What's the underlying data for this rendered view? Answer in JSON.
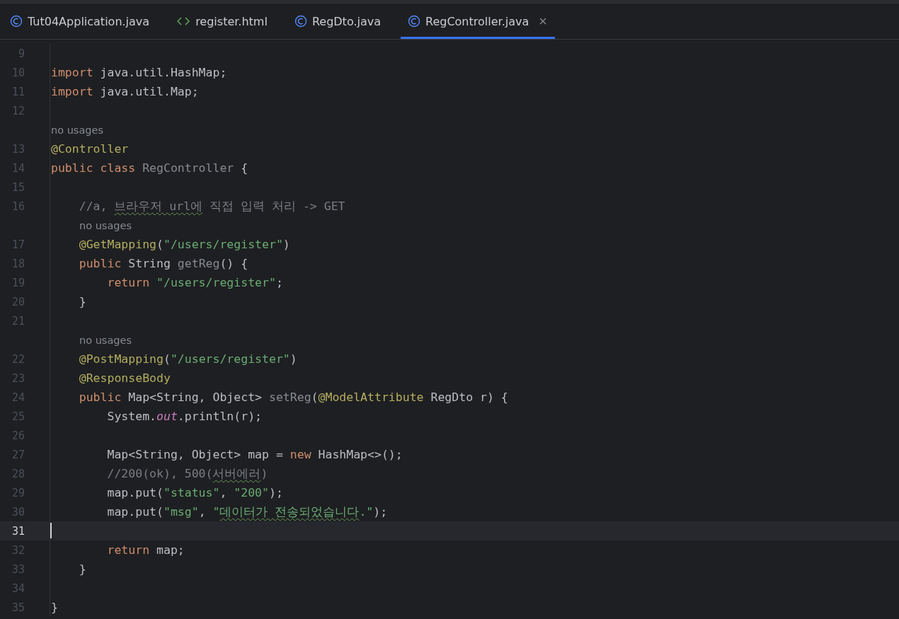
{
  "tabs": [
    {
      "label": "Tut04Application.java",
      "kind": "class",
      "selected": false,
      "closable": false
    },
    {
      "label": "register.html",
      "kind": "html",
      "selected": false,
      "closable": false
    },
    {
      "label": "RegDto.java",
      "kind": "class",
      "selected": false,
      "closable": false
    },
    {
      "label": "RegController.java",
      "kind": "class",
      "selected": true,
      "closable": true
    }
  ],
  "lines": [
    {
      "kind": "code",
      "number": "9",
      "current": false
    },
    {
      "kind": "code",
      "number": "10",
      "current": false,
      "tokens": [
        {
          "text": "import ",
          "kind": "keyword"
        },
        {
          "text": "java.util.HashMap;",
          "kind": "plain"
        }
      ]
    },
    {
      "kind": "code",
      "number": "11",
      "current": false,
      "tokens": [
        {
          "text": "import ",
          "kind": "keyword"
        },
        {
          "text": "java.util.Map;",
          "kind": "plain"
        }
      ]
    },
    {
      "kind": "code",
      "number": "12",
      "current": false
    },
    {
      "kind": "hint",
      "text": "no usages"
    },
    {
      "kind": "code",
      "number": "13",
      "current": false,
      "tokens": [
        {
          "text": "@Controller",
          "kind": "annotation"
        }
      ]
    },
    {
      "kind": "code",
      "number": "14",
      "current": false,
      "tokens": [
        {
          "text": "public class ",
          "kind": "keyword"
        },
        {
          "text": "RegController",
          "kind": "unused"
        },
        {
          "text": " {",
          "kind": "plain"
        }
      ]
    },
    {
      "kind": "code",
      "number": "15",
      "current": false
    },
    {
      "kind": "code",
      "number": "16",
      "current": false,
      "tokens": [
        {
          "text": "    //a, ",
          "kind": "comment"
        },
        {
          "text": "브라우저 url에",
          "kind": "comment-typo"
        },
        {
          "text": " 직접 입력 처리 -> GET",
          "kind": "comment"
        }
      ]
    },
    {
      "kind": "hint",
      "text": "no usages"
    },
    {
      "kind": "code",
      "number": "17",
      "current": false,
      "tokens": [
        {
          "text": "    @GetMapping",
          "kind": "annotation"
        },
        {
          "text": "(",
          "kind": "plain"
        },
        {
          "text": "\"/users/register\"",
          "kind": "string"
        },
        {
          "text": ")",
          "kind": "plain"
        }
      ]
    },
    {
      "kind": "code",
      "number": "18",
      "current": false,
      "tokens": [
        {
          "text": "    public ",
          "kind": "keyword"
        },
        {
          "text": "String ",
          "kind": "plain"
        },
        {
          "text": "getReg",
          "kind": "unused"
        },
        {
          "text": "() {",
          "kind": "plain"
        }
      ]
    },
    {
      "kind": "code",
      "number": "19",
      "current": false,
      "tokens": [
        {
          "text": "        return ",
          "kind": "keyword"
        },
        {
          "text": "\"/users/register\"",
          "kind": "string"
        },
        {
          "text": ";",
          "kind": "plain"
        }
      ]
    },
    {
      "kind": "code",
      "number": "20",
      "current": false,
      "tokens": [
        {
          "text": "    }",
          "kind": "plain"
        }
      ]
    },
    {
      "kind": "code",
      "number": "21",
      "current": false
    },
    {
      "kind": "hint",
      "text": "no usages"
    },
    {
      "kind": "code",
      "number": "22",
      "current": false,
      "tokens": [
        {
          "text": "    @PostMapping",
          "kind": "annotation"
        },
        {
          "text": "(",
          "kind": "plain"
        },
        {
          "text": "\"/users/register\"",
          "kind": "string"
        },
        {
          "text": ")",
          "kind": "plain"
        }
      ]
    },
    {
      "kind": "code",
      "number": "23",
      "current": false,
      "tokens": [
        {
          "text": "    @ResponseBody",
          "kind": "annotation"
        }
      ]
    },
    {
      "kind": "code",
      "number": "24",
      "current": false,
      "tokens": [
        {
          "text": "    public ",
          "kind": "keyword"
        },
        {
          "text": "Map<String, Object> ",
          "kind": "plain"
        },
        {
          "text": "setReg",
          "kind": "unused"
        },
        {
          "text": "(",
          "kind": "plain"
        },
        {
          "text": "@ModelAttribute",
          "kind": "annotation"
        },
        {
          "text": " RegDto r) {",
          "kind": "plain"
        }
      ]
    },
    {
      "kind": "code",
      "number": "25",
      "current": false,
      "tokens": [
        {
          "text": "        System.",
          "kind": "plain"
        },
        {
          "text": "out",
          "kind": "static"
        },
        {
          "text": ".println(r);",
          "kind": "plain"
        }
      ]
    },
    {
      "kind": "code",
      "number": "26",
      "current": false
    },
    {
      "kind": "code",
      "number": "27",
      "current": false,
      "tokens": [
        {
          "text": "        Map<String, Object> map = ",
          "kind": "plain"
        },
        {
          "text": "new ",
          "kind": "keyword"
        },
        {
          "text": "HashMap<>();",
          "kind": "plain"
        }
      ]
    },
    {
      "kind": "code",
      "number": "28",
      "current": false,
      "tokens": [
        {
          "text": "        //200(ok), 500(",
          "kind": "comment"
        },
        {
          "text": "서버에러",
          "kind": "comment-typo"
        },
        {
          "text": ")",
          "kind": "comment"
        }
      ]
    },
    {
      "kind": "code",
      "number": "29",
      "current": false,
      "tokens": [
        {
          "text": "        map.put(",
          "kind": "plain"
        },
        {
          "text": "\"status\"",
          "kind": "string"
        },
        {
          "text": ", ",
          "kind": "plain"
        },
        {
          "text": "\"200\"",
          "kind": "string"
        },
        {
          "text": ");",
          "kind": "plain"
        }
      ]
    },
    {
      "kind": "code",
      "number": "30",
      "current": false,
      "tokens": [
        {
          "text": "        map.put(",
          "kind": "plain"
        },
        {
          "text": "\"msg\"",
          "kind": "string"
        },
        {
          "text": ", ",
          "kind": "plain"
        },
        {
          "text": "\"",
          "kind": "string"
        },
        {
          "text": "데이터가 전송되었습니다",
          "kind": "string-typo"
        },
        {
          "text": ".\"",
          "kind": "string"
        },
        {
          "text": ");",
          "kind": "plain"
        }
      ]
    },
    {
      "kind": "code",
      "number": "31",
      "current": true
    },
    {
      "kind": "code",
      "number": "32",
      "current": false,
      "tokens": [
        {
          "text": "        return ",
          "kind": "keyword"
        },
        {
          "text": "map;",
          "kind": "plain"
        }
      ]
    },
    {
      "kind": "code",
      "number": "33",
      "current": false,
      "tokens": [
        {
          "text": "    }",
          "kind": "plain"
        }
      ]
    },
    {
      "kind": "code",
      "number": "34",
      "current": false
    },
    {
      "kind": "code",
      "number": "35",
      "current": false,
      "tokens": [
        {
          "text": "}",
          "kind": "plain"
        }
      ]
    }
  ]
}
